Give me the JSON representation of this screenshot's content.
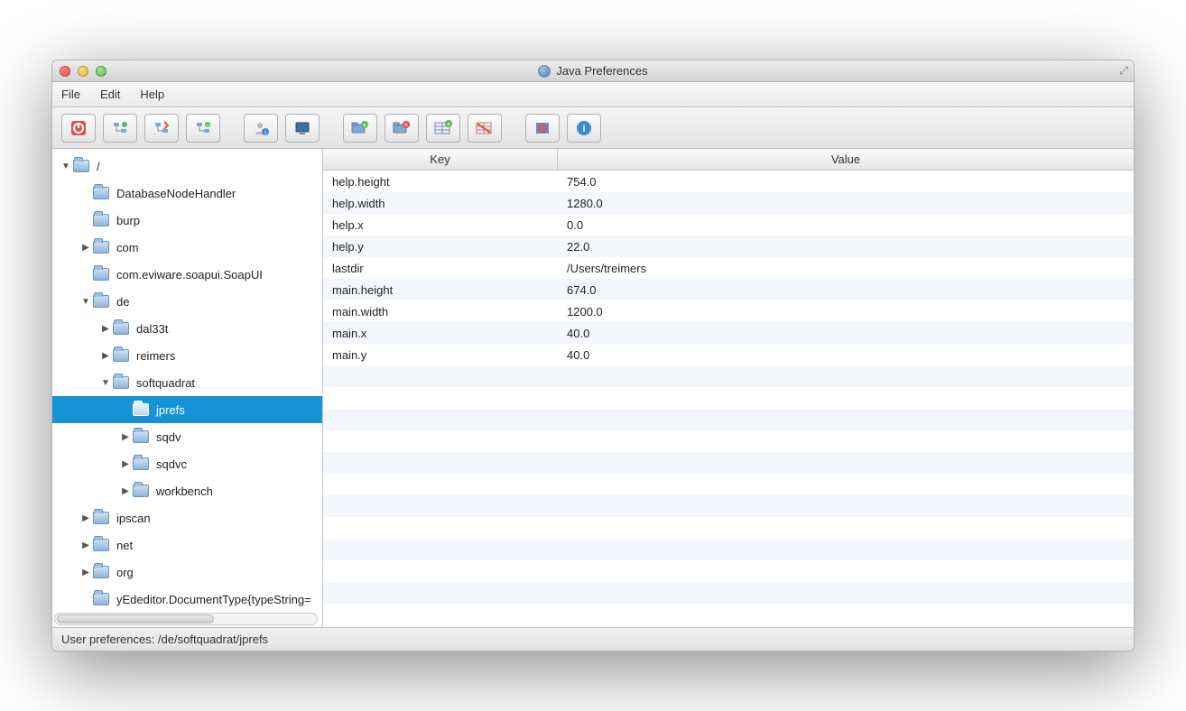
{
  "window": {
    "title": "Java Preferences"
  },
  "menu": {
    "file": "File",
    "edit": "Edit",
    "help": "Help"
  },
  "toolbar_icons": [
    "power-icon",
    "tree-add-icon",
    "tree-export-icon",
    "tree-refresh-icon",
    "user-info-icon",
    "monitor-icon",
    "folder-add-icon",
    "folder-remove-icon",
    "table-add-icon",
    "table-remove-icon",
    "target-icon",
    "info-icon"
  ],
  "tree": [
    {
      "label": "/",
      "depth": 0,
      "caret": "down",
      "selected": false
    },
    {
      "label": "DatabaseNodeHandler",
      "depth": 1,
      "caret": "none",
      "selected": false
    },
    {
      "label": "burp",
      "depth": 1,
      "caret": "none",
      "selected": false
    },
    {
      "label": "com",
      "depth": 1,
      "caret": "right",
      "selected": false
    },
    {
      "label": "com.eviware.soapui.SoapUI",
      "depth": 1,
      "caret": "none",
      "selected": false
    },
    {
      "label": "de",
      "depth": 1,
      "caret": "down",
      "selected": false
    },
    {
      "label": "dal33t",
      "depth": 2,
      "caret": "right",
      "selected": false
    },
    {
      "label": "reimers",
      "depth": 2,
      "caret": "right",
      "selected": false
    },
    {
      "label": "softquadrat",
      "depth": 2,
      "caret": "down",
      "selected": false
    },
    {
      "label": "jprefs",
      "depth": 3,
      "caret": "none",
      "selected": true
    },
    {
      "label": "sqdv",
      "depth": 3,
      "caret": "right",
      "selected": false
    },
    {
      "label": "sqdvc",
      "depth": 3,
      "caret": "right",
      "selected": false
    },
    {
      "label": "workbench",
      "depth": 3,
      "caret": "right",
      "selected": false
    },
    {
      "label": "ipscan",
      "depth": 1,
      "caret": "right",
      "selected": false
    },
    {
      "label": "net",
      "depth": 1,
      "caret": "right",
      "selected": false
    },
    {
      "label": "org",
      "depth": 1,
      "caret": "right",
      "selected": false
    },
    {
      "label": "yEdeditor.DocumentType{typeString=",
      "depth": 1,
      "caret": "none",
      "selected": false
    }
  ],
  "table": {
    "headers": {
      "key": "Key",
      "value": "Value"
    },
    "rows": [
      {
        "key": "help.height",
        "value": "754.0"
      },
      {
        "key": "help.width",
        "value": "1280.0"
      },
      {
        "key": "help.x",
        "value": "0.0"
      },
      {
        "key": "help.y",
        "value": "22.0"
      },
      {
        "key": "lastdir",
        "value": "/Users/treimers"
      },
      {
        "key": "main.height",
        "value": "674.0"
      },
      {
        "key": "main.width",
        "value": "1200.0"
      },
      {
        "key": "main.x",
        "value": "40.0"
      },
      {
        "key": "main.y",
        "value": "40.0"
      }
    ],
    "blank_rows": 12
  },
  "status": "User preferences: /de/softquadrat/jprefs"
}
